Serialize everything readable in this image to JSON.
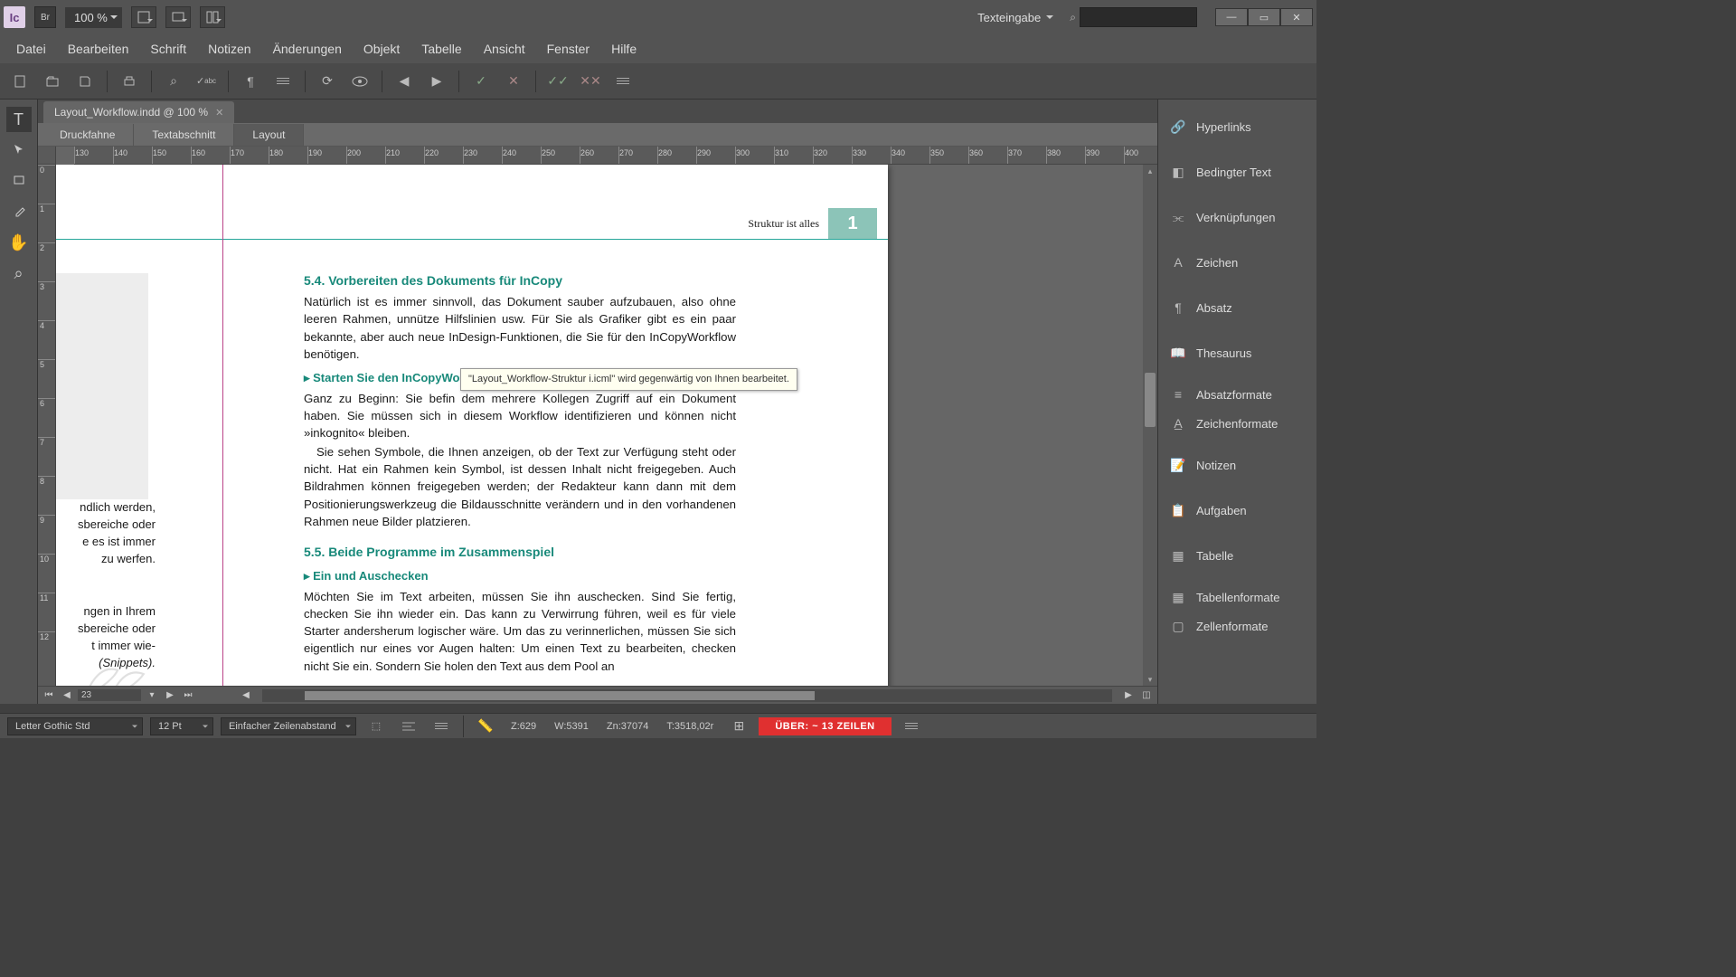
{
  "app_icon": "Ic",
  "zoom": "100 %",
  "mode": "Texteingabe",
  "menu": [
    "Datei",
    "Bearbeiten",
    "Schrift",
    "Notizen",
    "Änderungen",
    "Objekt",
    "Tabelle",
    "Ansicht",
    "Fenster",
    "Hilfe"
  ],
  "doc_tab": {
    "title": "Layout_Workflow.indd @ 100 %"
  },
  "view_tabs": [
    "Druckfahne",
    "Textabschnitt",
    "Layout"
  ],
  "ruler_h": [
    130,
    140,
    150,
    160,
    170,
    180,
    190,
    200,
    210,
    220,
    230,
    240,
    250,
    260,
    270,
    280,
    290,
    300,
    310,
    320,
    330,
    340,
    350,
    360,
    370,
    380,
    390,
    400
  ],
  "ruler_v": [
    0,
    1,
    2,
    3,
    4,
    5,
    6,
    7,
    8,
    9,
    10,
    11,
    12
  ],
  "page": {
    "number": "1",
    "header": "Struktur ist alles",
    "h3a": "5.4.  Vorbereiten des Dokuments für InCopy",
    "p1": "Natürlich ist es immer sinnvoll, das Dokument sauber aufzubauen, also ohne leeren Rahmen, unnütze Hilfslinien usw. Für Sie als Grafiker gibt es ein paar bekannte, aber auch neue InDesign-Funktionen, die Sie für den InCopyWorkflow benötigen.",
    "h4a": "Starten Sie den InCopyWo",
    "p2": "Ganz zu Beginn: Sie befin                                                       dem meh­rere Kollegen Zugriff auf ein Dokument haben. Sie müssen sich in diesem Workflow identifizieren und können nicht »inkognito« bleiben.",
    "p3": "Sie sehen Symbole, die Ihnen anzeigen, ob der Text zur Verfügung steht oder nicht. Hat ein Rahmen kein Symbol, ist dessen Inhalt nicht freigege­ben. Auch Bildrahmen können freigegeben werden; der Redakteur kann dann mit dem Positionierungswerkzeug die Bildausschnitte verändern und in den vorhandenen Rahmen neue Bilder platzieren.",
    "h3b": "5.5.  Beide Programme im Zusammenspiel",
    "h4b": "Ein und Auschecken",
    "p4": "Möchten Sie im Text arbeiten, müssen Sie ihn auschecken. Sind Sie fertig, checken Sie ihn wieder ein. Das kann zu Verwirrung führen, weil es für vie­le Starter andersherum logischer wäre. Um das zu verinnerlichen, müssen Sie sich eigentlich nur eines vor Augen halten: Um einen Text zu bearbei­ten, checken nicht Sie ein. Sondern Sie holen den Text aus dem Pool an",
    "frag1": "ndlich werden,",
    "frag2": "sbereiche oder",
    "frag3": "e es ist immer",
    "frag4": "zu werfen.",
    "frag5": "ngen in Ihrem",
    "frag6": "sbereiche oder",
    "frag7": "t immer wie-",
    "frag8": "(Snippets)."
  },
  "tooltip": "\"Layout_Workflow-Struktur i.icml\" wird gegenwärtig von Ihnen bearbeitet.",
  "page_nav": "23",
  "panels": [
    "Hyperlinks",
    "Bedingter Text",
    "Verknüpfungen",
    "Zeichen",
    "Absatz",
    "Thesaurus",
    "Absatzformate",
    "Zeichenformate",
    "Notizen",
    "Aufgaben",
    "Tabelle",
    "Tabellenformate",
    "Zellenformate"
  ],
  "status": {
    "font": "Letter Gothic Std",
    "size": "12 Pt",
    "leading": "Einfacher Zeilenabstand",
    "z": "Z:629",
    "w": "W:5391",
    "zn": "Zn:37074",
    "t": "T:3518,02r",
    "warn": "ÜBER:  ~ 13 ZEILEN"
  }
}
